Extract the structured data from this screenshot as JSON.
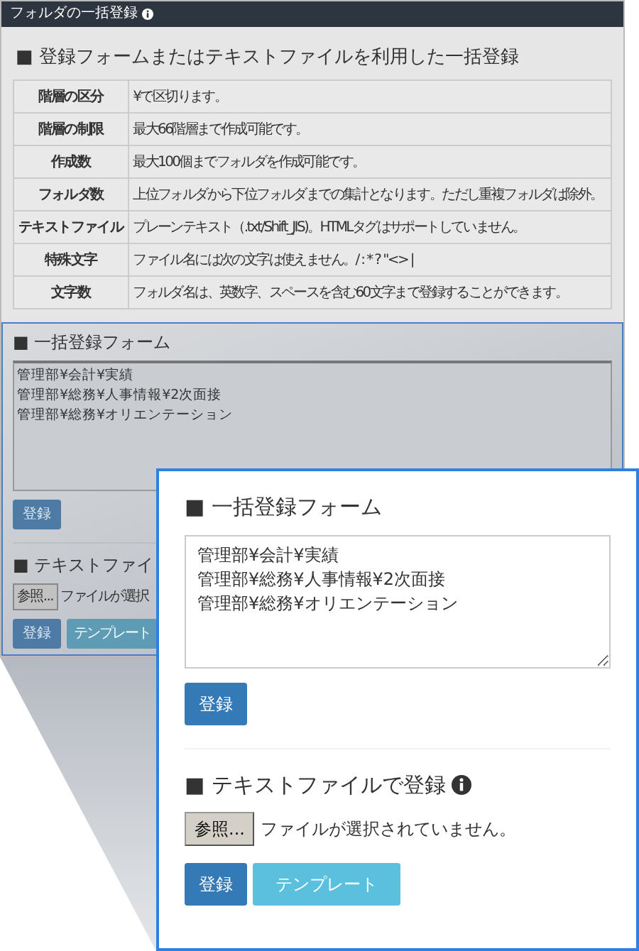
{
  "panel": {
    "title": "フォルダの一括登録",
    "section_title": "■ 登録フォームまたはテキストファイルを利用した一括登録",
    "table": {
      "rows": [
        {
          "label": "階層の区分",
          "value": "¥で区切ります。"
        },
        {
          "label": "階層の制限",
          "value": "最大66階層まで作成可能です。"
        },
        {
          "label": "作成数",
          "value": "最大100個までフォルダを作成可能です。"
        },
        {
          "label": "フォルダ数",
          "value": "上位フォルダから下位フォルダまでの集計となります。ただし重複フォルダは除外。"
        },
        {
          "label": "テキストファイル",
          "value": "プレーンテキスト（.txt/Shift_JIS)。HTMLタグはサポートしていません。"
        },
        {
          "label": "特殊文字",
          "value": "ファイル名には次の文字は使えません。/ : * ? \"<> |"
        },
        {
          "label": "文字数",
          "value": "フォルダ名は、英数字、スペースを含む60文字まで登録することができます。"
        }
      ]
    }
  },
  "background_form": {
    "heading": "■ 一括登録フォーム",
    "lines": [
      "管理部¥会計¥実績",
      "管理部¥総務¥人事情報¥2次面接",
      "管理部¥総務¥オリエンテーション"
    ],
    "submit": "登録",
    "file_heading": "■ テキストファイ",
    "browse": "参照...",
    "file_status": "ファイルが選択",
    "buttons": [
      {
        "label": "登録",
        "kind": "primary"
      },
      {
        "label": "テンプレート",
        "kind": "info"
      }
    ]
  },
  "callout": {
    "heading": "■ 一括登録フォーム",
    "lines": [
      "管理部¥会計¥実績",
      "管理部¥総務¥人事情報¥2次面接",
      "管理部¥総務¥オリエンテーション"
    ],
    "submit": "登録",
    "file_heading": "■ テキストファイルで登録",
    "browse": "参照...",
    "file_status": "ファイルが選択されていません。",
    "buttons": [
      {
        "label": "登録",
        "kind": "primary"
      },
      {
        "label": "テンプレート",
        "kind": "info"
      }
    ]
  }
}
